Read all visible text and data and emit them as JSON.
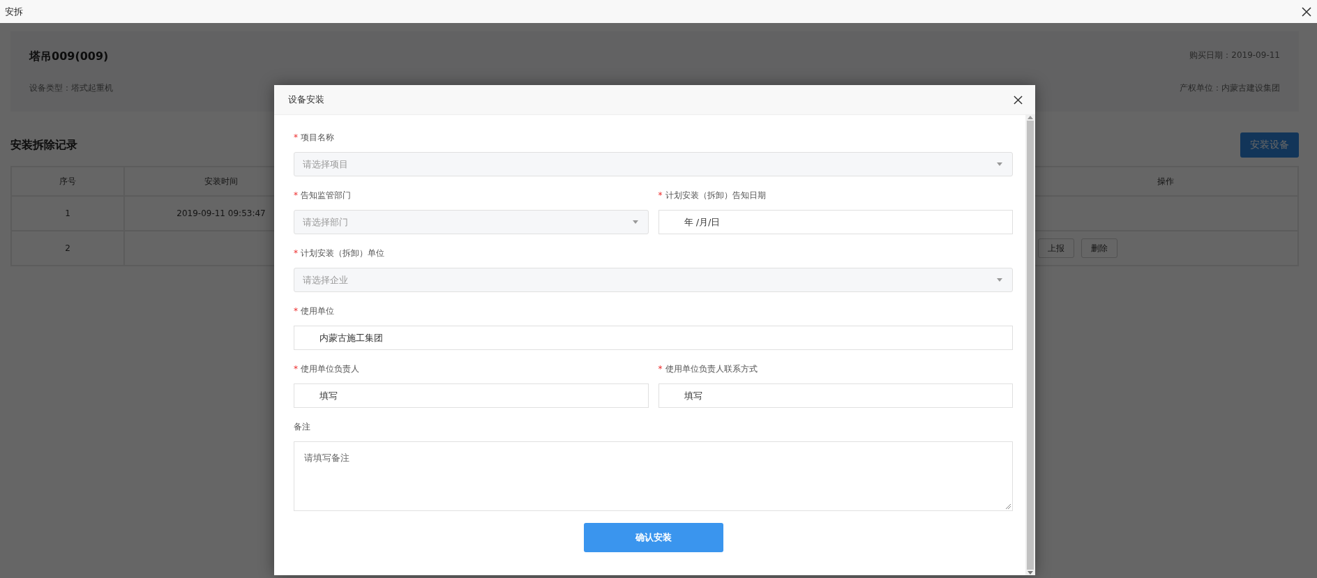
{
  "window": {
    "title": "安拆"
  },
  "equipment": {
    "name": "塔吊009(009)",
    "purchase_date": "购买日期：2019-09-11",
    "type": "设备类型：塔式起重机",
    "owner": "产权单位：内蒙古建设集团"
  },
  "records": {
    "title": "安装拆除记录",
    "add_button": "安装设备",
    "columns": [
      {
        "label": "序号"
      },
      {
        "label": "安装时间"
      },
      {
        "label": "操作"
      }
    ],
    "rows": [
      {
        "index": "1",
        "time": "2019-09-11 09:53:47",
        "actions": []
      },
      {
        "index": "2",
        "actions": [
          "上报",
          "删除"
        ]
      }
    ]
  },
  "dialog": {
    "title": "设备安装",
    "rows": [
      [
        {
          "kind": "select",
          "label": "项目名称",
          "required_mark": "*",
          "placeholder": "请选择项目"
        }
      ],
      [
        {
          "kind": "select",
          "label": "告知监管部门",
          "required_mark": "*",
          "placeholder": "请选择部门"
        },
        {
          "kind": "date",
          "label": "计划安装（拆卸）告知日期",
          "required_mark": "*",
          "value": "年 /月/日"
        }
      ],
      [
        {
          "kind": "select",
          "label": "计划安装（拆卸）单位",
          "required_mark": "*",
          "placeholder": "请选择企业"
        }
      ],
      [
        {
          "kind": "text",
          "label": "使用单位",
          "required_mark": "*",
          "value": "内蒙古施工集团"
        }
      ],
      [
        {
          "kind": "text",
          "label": "使用单位负责人",
          "required_mark": "*",
          "value": "填写"
        },
        {
          "kind": "text",
          "label": "使用单位负责人联系方式",
          "required_mark": "*",
          "value": "填写"
        }
      ],
      [
        {
          "kind": "textarea",
          "label": "备注",
          "placeholder": "请填写备注"
        }
      ]
    ],
    "submit": "确认安装"
  }
}
